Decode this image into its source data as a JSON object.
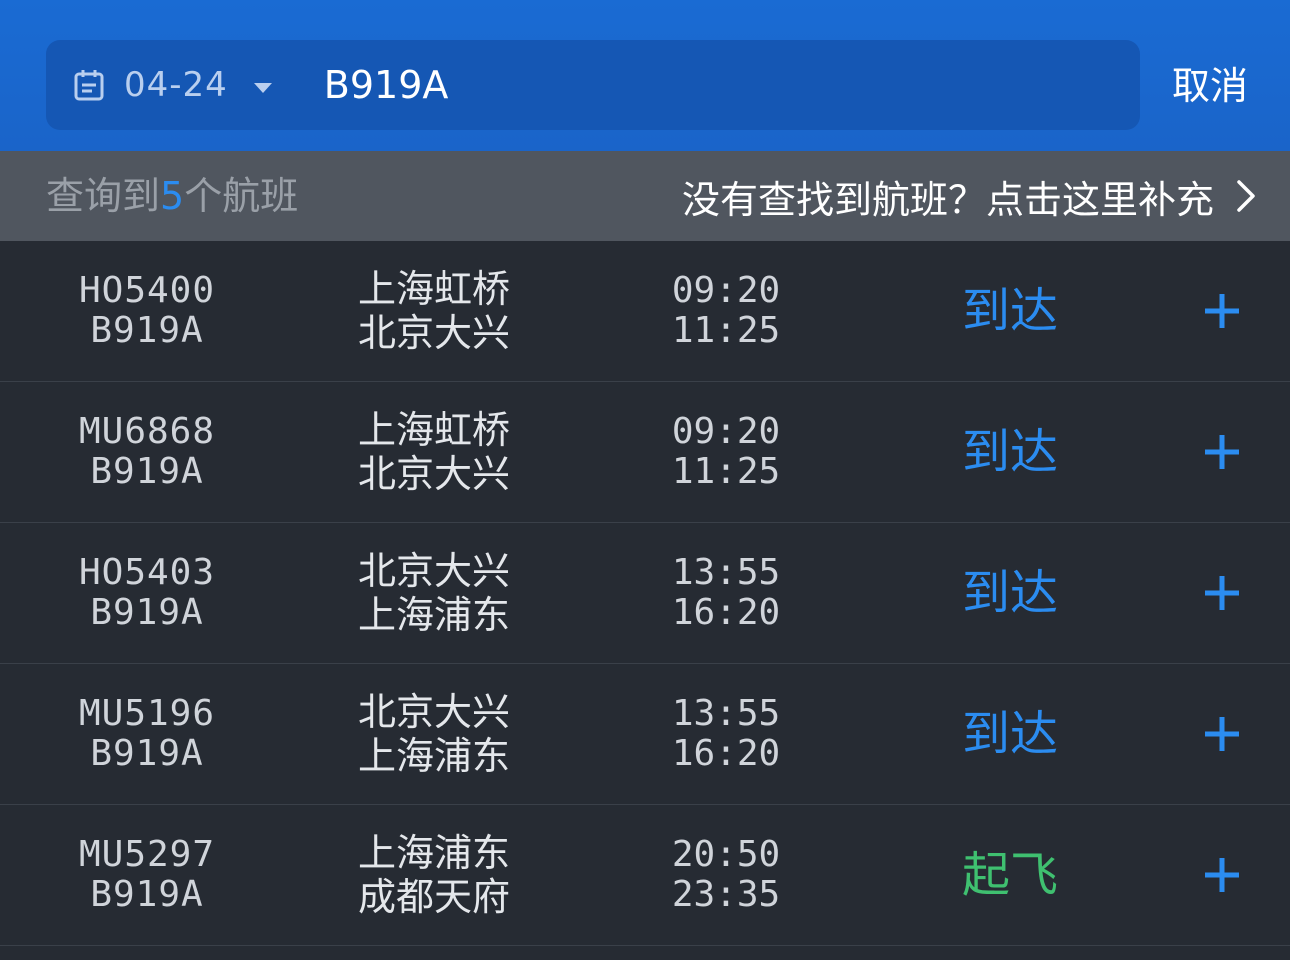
{
  "header": {
    "date": "04-24",
    "search_value": "B919A",
    "cancel_label": "取消"
  },
  "summary": {
    "prefix": "查询到",
    "count": "5",
    "suffix": "个航班",
    "report_link": "没有查找到航班？点击这里补充"
  },
  "colors": {
    "header_bg": "#1a6bd3",
    "accent_blue": "#2b8cf0",
    "status_departed": "#3fc070"
  },
  "flights": [
    {
      "flight_no": "HO5400",
      "aircraft": "B919A",
      "origin": "上海虹桥",
      "destination": "北京大兴",
      "dep_time": "09:20",
      "arr_time": "11:25",
      "status": "到达",
      "status_color": "#2b8cf0"
    },
    {
      "flight_no": "MU6868",
      "aircraft": "B919A",
      "origin": "上海虹桥",
      "destination": "北京大兴",
      "dep_time": "09:20",
      "arr_time": "11:25",
      "status": "到达",
      "status_color": "#2b8cf0"
    },
    {
      "flight_no": "HO5403",
      "aircraft": "B919A",
      "origin": "北京大兴",
      "destination": "上海浦东",
      "dep_time": "13:55",
      "arr_time": "16:20",
      "status": "到达",
      "status_color": "#2b8cf0"
    },
    {
      "flight_no": "MU5196",
      "aircraft": "B919A",
      "origin": "北京大兴",
      "destination": "上海浦东",
      "dep_time": "13:55",
      "arr_time": "16:20",
      "status": "到达",
      "status_color": "#2b8cf0"
    },
    {
      "flight_no": "MU5297",
      "aircraft": "B919A",
      "origin": "上海浦东",
      "destination": "成都天府",
      "dep_time": "20:50",
      "arr_time": "23:35",
      "status": "起飞",
      "status_color": "#3fc070"
    }
  ]
}
